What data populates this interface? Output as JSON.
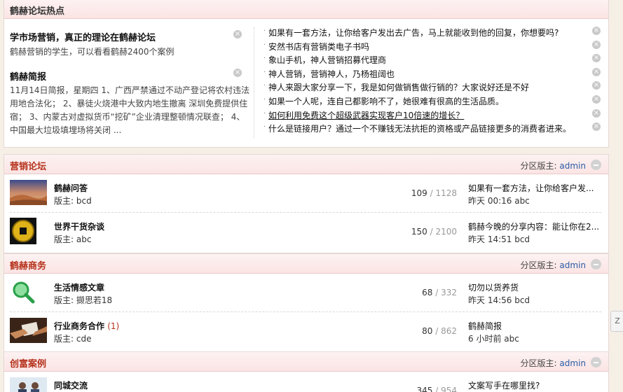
{
  "hot": {
    "title": "鹤赫论坛热点",
    "featured": [
      {
        "title": "学市场营销，真正的理论在鹤赫论坛",
        "text": "鹤赫营销的学生，可以看看鹤赫2400个案例"
      },
      {
        "title": "鹤赫简报",
        "text": "11月14日简报，星期四 1、广西严禁通过不动产登记将农村违法用地合法化； 2、暴徒火烧港中大致内地生撤离 深圳免费提供住宿； 3、内蒙古对虚拟货币“挖矿”企业清理整顿情况联查； 4、中国最大垃圾填埋场将关闭 ..."
      }
    ],
    "links": [
      "如果有一套方法，让你给客户发出去广告，马上就能收到他的回复，你想要吗?",
      "安然书店有营销类电子书吗",
      "象山手机，神人营销招募代理商",
      "神人营销，营销神人，乃杨祖阔也",
      "神人来跟大家分享一下，我是如何做销售做行销的？大家说好还是不好",
      "如果一个人呢，连自己都影响不了，她很难有很高的生活品质。",
      "如何利用免费这个超级武器实现客户10倍速的增长？",
      "什么是链接用户？通过一个不赚钱无法抗拒的资格或产品链接更多的消费者进来。"
    ]
  },
  "sections": [
    {
      "title": "营销论坛",
      "moderator_label": "分区版主:",
      "moderator": "admin",
      "forums": [
        {
          "name": "鹤赫问答",
          "new": "",
          "mod": "版主: bcd",
          "threads": "109",
          "posts": "1128",
          "last_title": "如果有一套方法，让你给客户发...",
          "last_meta": "昨天 00:16 abc",
          "icon": "desert-image"
        },
        {
          "name": "世界干货杂谈",
          "new": "",
          "mod": "版主: abc",
          "threads": "150",
          "posts": "2100",
          "last_title": "鹤赫今晚的分享内容：能让你在2...",
          "last_meta": "昨天 14:51 bcd",
          "icon": "coin-image"
        }
      ]
    },
    {
      "title": "鹤赫商务",
      "moderator_label": "分区版主:",
      "moderator": "admin",
      "forums": [
        {
          "name": "生活情感文章",
          "new": "",
          "mod": "版主: 撷思若18",
          "threads": "68",
          "posts": "332",
          "last_title": "切勿以货养货",
          "last_meta": "昨天 14:56 bcd",
          "icon": "magnifier-icon"
        },
        {
          "name": "行业商务合作",
          "new": "(1)",
          "mod": "版主: cde",
          "threads": "80",
          "posts": "862",
          "last_title": "鹤赫简报",
          "last_meta": "6 小时前 abc",
          "icon": "handshake-image"
        }
      ]
    },
    {
      "title": "创富案例",
      "moderator_label": "分区版主:",
      "moderator": "admin",
      "forums": [
        {
          "name": "同城交流",
          "new": "",
          "mod": "",
          "threads": "345",
          "posts": "954",
          "last_title": "文案写手在哪里找?",
          "last_meta": "",
          "icon": "people-image"
        }
      ]
    }
  ],
  "side_tab": "Z",
  "colors": {
    "accent": "#b5321c",
    "link": "#2a5ca6",
    "header_bg": "#fbe4e4",
    "page_bg": "#f6efe6"
  }
}
